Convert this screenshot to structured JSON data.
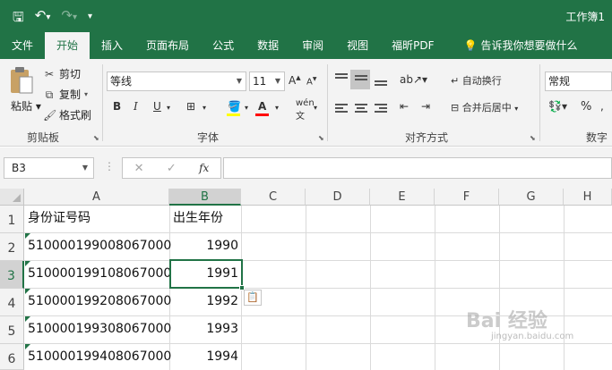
{
  "qat": {
    "save_icon": "save-icon",
    "undo_icon": "undo-icon",
    "redo_icon": "redo-icon",
    "customize_icon": "customize-qat-icon"
  },
  "window": {
    "title": "工作簿1"
  },
  "tabs": [
    {
      "label": "文件"
    },
    {
      "label": "开始"
    },
    {
      "label": "插入"
    },
    {
      "label": "页面布局"
    },
    {
      "label": "公式"
    },
    {
      "label": "数据"
    },
    {
      "label": "审阅"
    },
    {
      "label": "视图"
    },
    {
      "label": "福昕PDF"
    }
  ],
  "tell_me": "告诉我你想要做什么",
  "ribbon": {
    "clipboard": {
      "paste": "粘贴",
      "cut": "剪切",
      "copy": "复制",
      "format_painter": "格式刷",
      "group": "剪贴板"
    },
    "font": {
      "name": "等线",
      "size": "11",
      "bold": "B",
      "italic": "I",
      "underline": "U",
      "group": "字体",
      "fill_color": "#ffff00",
      "font_color": "#ff0000"
    },
    "alignment": {
      "wrap": "自动换行",
      "merge": "合并后居中",
      "group": "对齐方式"
    },
    "number": {
      "format": "常规",
      "percent": "%",
      "group": "数字"
    }
  },
  "formula_bar": {
    "name_box": "B3",
    "fx": "fx",
    "value": ""
  },
  "grid": {
    "columns": [
      "A",
      "B",
      "C",
      "D",
      "E",
      "F",
      "G",
      "H"
    ],
    "rows": [
      "1",
      "2",
      "3",
      "4",
      "5",
      "6"
    ],
    "cells": [
      [
        "身份证号码",
        "出生年份"
      ],
      [
        "510000199008067000",
        "1990"
      ],
      [
        "510000199108067000",
        "1991"
      ],
      [
        "510000199208067000",
        "1992"
      ],
      [
        "510000199308067000",
        "1993"
      ],
      [
        "510000199408067000",
        "1994"
      ]
    ],
    "selected": "B3"
  },
  "watermark": {
    "main": "Bai 经验",
    "sub": "jingyan.baidu.com"
  },
  "colors": {
    "accent": "#217346"
  }
}
